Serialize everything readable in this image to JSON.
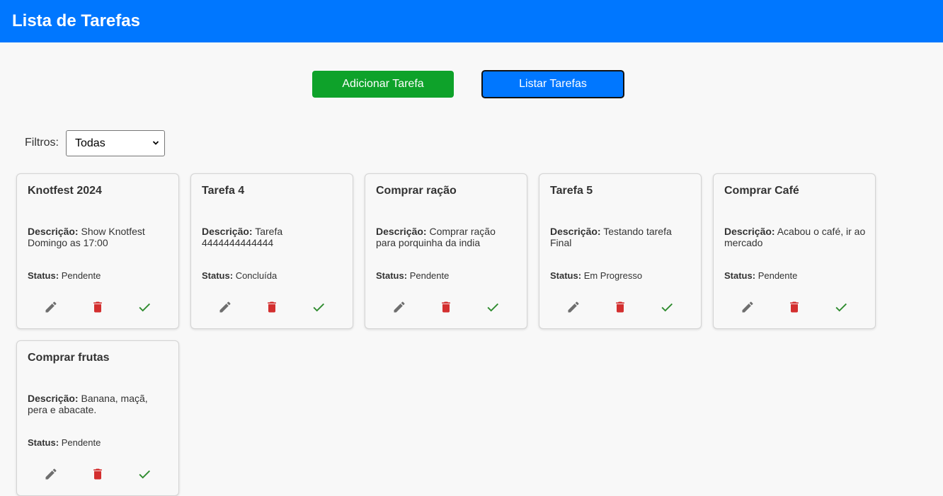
{
  "header": {
    "title": "Lista de Tarefas"
  },
  "actions": {
    "add_label": "Adicionar Tarefa",
    "list_label": "Listar Tarefas"
  },
  "filter": {
    "label": "Filtros:",
    "selected": "Todas"
  },
  "labels": {
    "description": "Descrição:",
    "status": "Status:"
  },
  "colors": {
    "header": "#0077ff",
    "add_button": "#0ea22a",
    "edit_icon": "#6e6e6e",
    "delete_icon": "#d32f2f",
    "done_icon": "#2e8b2e"
  },
  "icons": {
    "edit": "pencil-icon",
    "delete": "trash-icon",
    "done": "check-icon"
  },
  "tasks": [
    {
      "title": "Knotfest 2024",
      "description": "Show Knotfest Domingo as 17:00",
      "status": "Pendente"
    },
    {
      "title": "Tarefa 4",
      "description": "Tarefa 4444444444444",
      "status": "Concluída"
    },
    {
      "title": "Comprar ração",
      "description": "Comprar ração para porquinha da india",
      "status": "Pendente"
    },
    {
      "title": "Tarefa 5",
      "description": "Testando tarefa Final",
      "status": "Em Progresso"
    },
    {
      "title": "Comprar Café",
      "description": "Acabou o café, ir ao mercado",
      "status": "Pendente"
    },
    {
      "title": "Comprar frutas",
      "description": "Banana, maçã, pera e abacate.",
      "status": "Pendente"
    }
  ]
}
